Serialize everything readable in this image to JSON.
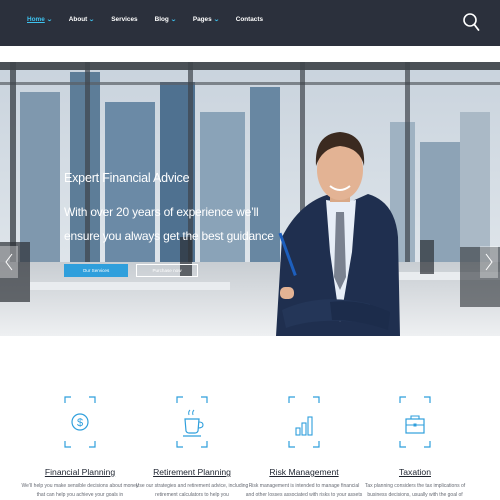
{
  "nav": {
    "items": [
      {
        "label": "Home",
        "active": true,
        "dropdown": true
      },
      {
        "label": "About",
        "active": false,
        "dropdown": true
      },
      {
        "label": "Services",
        "active": false,
        "dropdown": false
      },
      {
        "label": "Blog",
        "active": false,
        "dropdown": true
      },
      {
        "label": "Pages",
        "active": false,
        "dropdown": true
      },
      {
        "label": "Contacts",
        "active": false,
        "dropdown": false
      }
    ],
    "search_icon": "search-icon"
  },
  "hero": {
    "title": "Expert Financial Advice",
    "subtitle": "With over 20 years of experience we’ll ensure you always get the best guidance",
    "primary_button": "Our Services",
    "secondary_button": "Purchase now",
    "prev_icon": "chevron-left-icon",
    "next_icon": "chevron-right-icon"
  },
  "services": [
    {
      "title": "Financial Planning",
      "desc": "We’ll help you make sensible decisions about money that can help you achieve your goals in",
      "icon": "dollar-icon"
    },
    {
      "title": "Retirement Planning",
      "desc": "Use our strategies and retirement advice, including retirement calculators to help you",
      "icon": "coffee-cup-icon"
    },
    {
      "title": "Risk Management",
      "desc": "Risk management is intended to manage financial and other losses associated with risks to your assets",
      "icon": "bar-chart-icon"
    },
    {
      "title": "Taxation",
      "desc": "Tax planning considers the tax implications of business decisions, usually with the goal of",
      "icon": "briefcase-icon"
    }
  ],
  "colors": {
    "topbar": "#2b303c",
    "accent": "#2f9fdc",
    "nav_active": "#3ec3f0"
  }
}
